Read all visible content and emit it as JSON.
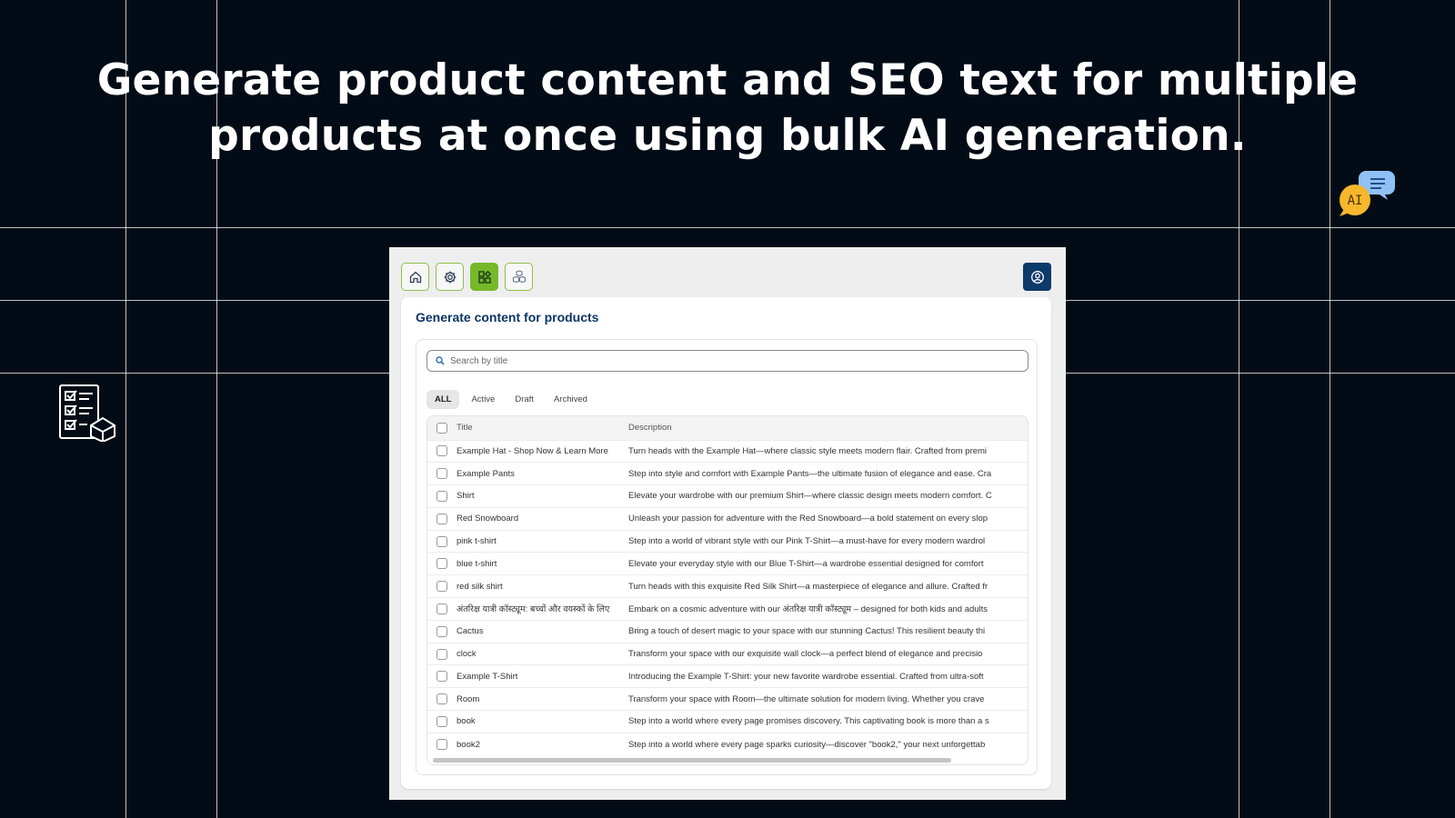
{
  "headline": {
    "line1": "Generate product content and SEO text for multiple",
    "line2": "products at once using bulk AI generation."
  },
  "decor": {
    "left_icon": "checklist-box-icon",
    "right_icon": "ai-chat-bubble-icon",
    "ai_label": "AI"
  },
  "toolbar": {
    "buttons": [
      "home-icon",
      "settings-icon",
      "apps-grid-icon",
      "boxes-icon"
    ],
    "active_index": 2,
    "account": "account-icon"
  },
  "page": {
    "title": "Generate content for products",
    "search_placeholder": "Search by title"
  },
  "tabs": [
    "ALL",
    "Active",
    "Draft",
    "Archived"
  ],
  "table": {
    "columns": [
      "Title",
      "Description"
    ],
    "rows": [
      {
        "title": "Example Hat - Shop Now & Learn More",
        "description": "Turn heads with the Example Hat—where classic style meets modern flair. Crafted from premi"
      },
      {
        "title": "Example Pants",
        "description": "Step into style and comfort with Example Pants—the ultimate fusion of elegance and ease. Cra"
      },
      {
        "title": "Shirt",
        "description": "Elevate your wardrobe with our premium Shirt—where classic design meets modern comfort. C"
      },
      {
        "title": "Red Snowboard",
        "description": "Unleash your passion for adventure with the Red Snowboard—a bold statement on every slop"
      },
      {
        "title": "pink t-shirt",
        "description": "Step into a world of vibrant style with our Pink T-Shirt—a must-have for every modern wardrol"
      },
      {
        "title": "blue t-shirt",
        "description": "Elevate your everyday style with our Blue T-Shirt—a wardrobe essential designed for comfort"
      },
      {
        "title": "red silk shirt",
        "description": "Turn heads with this exquisite Red Silk Shirt—a masterpiece of elegance and allure. Crafted fr"
      },
      {
        "title": "अंतरिक्ष यात्री कॉस्ट्यूम: बच्चों और वयस्कों के लिए",
        "description": "Embark on a cosmic adventure with our अंतरिक्ष यात्री कॉस्ट्यूम – designed for both kids and adults"
      },
      {
        "title": "Cactus",
        "description": "Bring a touch of desert magic to your space with our stunning Cactus! This resilient beauty thi"
      },
      {
        "title": "clock",
        "description": "Transform your space with our exquisite wall clock—a perfect blend of elegance and precisio"
      },
      {
        "title": "Example T-Shirt",
        "description": "Introducing the Example T-Shirt: your new favorite wardrobe essential. Crafted from ultra-soft"
      },
      {
        "title": "Room",
        "description": "Transform your space with Room—the ultimate solution for modern living. Whether you crave"
      },
      {
        "title": "book",
        "description": "Step into a world where every page promises discovery. This captivating book is more than a s"
      },
      {
        "title": "book2",
        "description": "Step into a world where every page sparks curiosity—discover \"book2,\" your next unforgettab"
      }
    ]
  },
  "colors": {
    "background": "#030c16",
    "accent_green": "#76b82a",
    "title_blue": "#0b3566",
    "account_blue": "#0c3a6b"
  }
}
